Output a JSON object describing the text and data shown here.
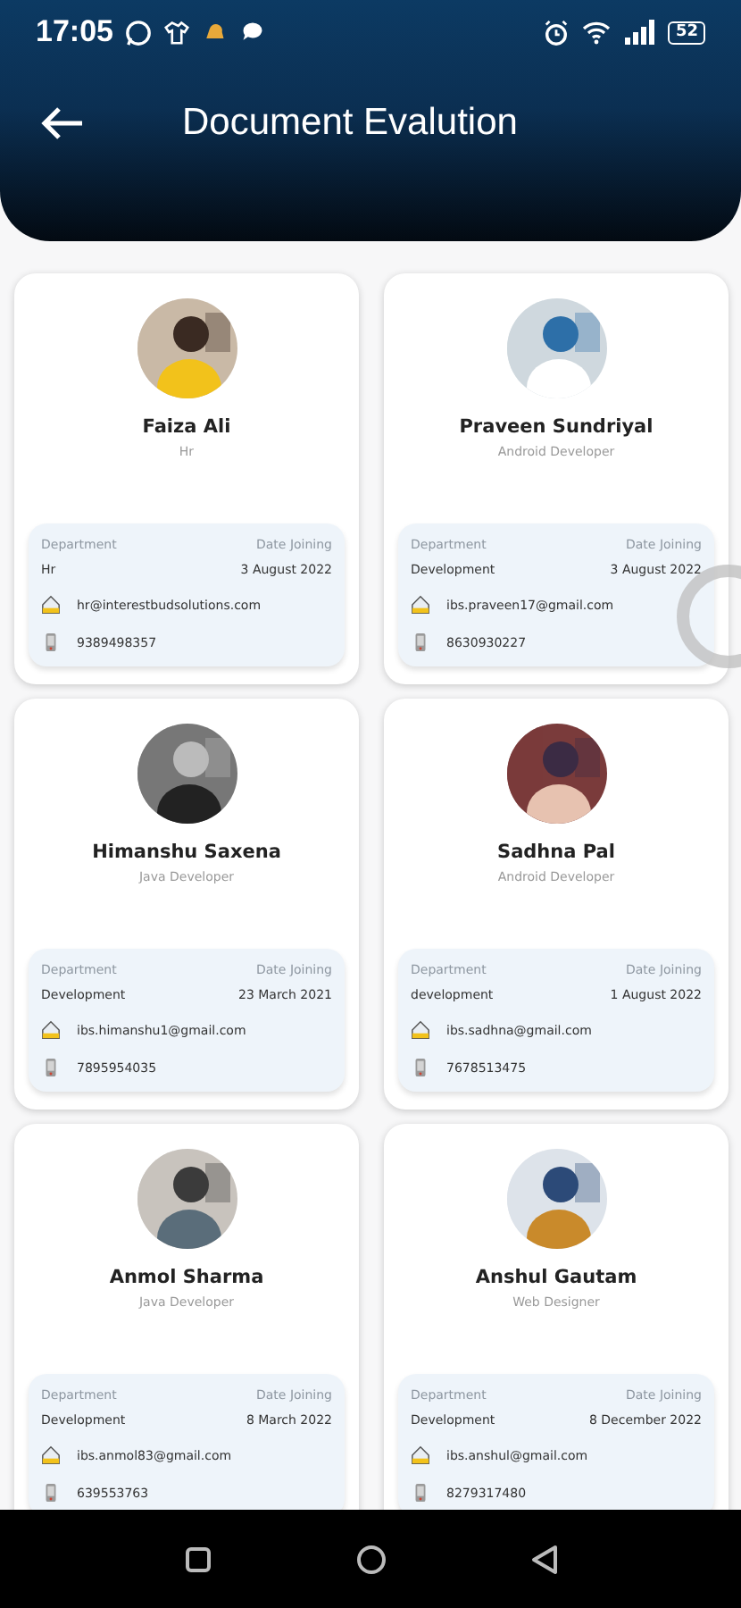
{
  "status_bar": {
    "time": "17:05",
    "battery": "52"
  },
  "header": {
    "title": "Document Evalution"
  },
  "employees": [
    {
      "name": "Faiza  Ali",
      "role": "Hr",
      "department_label": "Department",
      "department": "Hr",
      "date_label": "Date Joining",
      "date": "3 August 2022",
      "email": "hr@interestbudsolutions.com",
      "phone": "9389498357"
    },
    {
      "name": "Praveen Sundriyal",
      "role": "Android Developer",
      "department_label": "Department",
      "department": "Development",
      "date_label": "Date Joining",
      "date": "3 August 2022",
      "email": "ibs.praveen17@gmail.com",
      "phone": "8630930227"
    },
    {
      "name": "Himanshu Saxena",
      "role": "Java Developer",
      "department_label": "Department",
      "department": "Development",
      "date_label": "Date Joining",
      "date": "23 March 2021",
      "email": "ibs.himanshu1@gmail.com",
      "phone": "7895954035"
    },
    {
      "name": "Sadhna Pal",
      "role": "Android Developer",
      "department_label": "Department",
      "department": "development",
      "date_label": "Date Joining",
      "date": "1 August 2022",
      "email": "ibs.sadhna@gmail.com",
      "phone": "7678513475"
    },
    {
      "name": "Anmol Sharma",
      "role": "Java Developer",
      "department_label": "Department",
      "department": "Development",
      "date_label": "Date Joining",
      "date": "8 March 2022",
      "email": "ibs.anmol83@gmail.com",
      "phone": "639553763"
    },
    {
      "name": "Anshul Gautam",
      "role": "Web Designer",
      "department_label": "Department",
      "department": "Development",
      "date_label": "Date Joining",
      "date": "8 December 2022",
      "email": "ibs.anshul@gmail.com",
      "phone": "8279317480"
    }
  ]
}
